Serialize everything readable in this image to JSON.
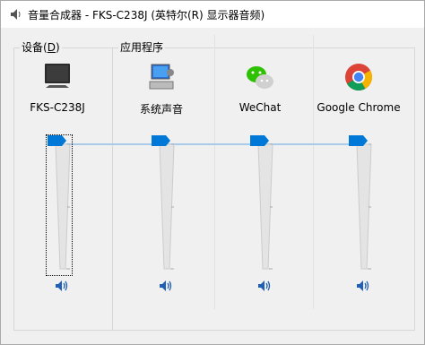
{
  "window": {
    "title": "音量合成器 - FKS-C238J (英特尔(R) 显示器音频)"
  },
  "device_group": {
    "title": "设备",
    "accesskey": "D",
    "device": {
      "name": "FKS-C238J",
      "icon": "monitor-icon",
      "volume_percent": 100,
      "muted": false
    }
  },
  "apps_group": {
    "title": "应用程序",
    "apps": [
      {
        "name": "系统声音",
        "icon": "system-sounds-icon",
        "volume_percent": 100,
        "muted": false
      },
      {
        "name": "WeChat",
        "icon": "wechat-icon",
        "volume_percent": 100,
        "muted": false
      },
      {
        "name": "Google Chrome",
        "icon": "chrome-icon",
        "volume_percent": 100,
        "muted": false
      }
    ]
  },
  "colors": {
    "accent": "#0078d7",
    "track": "#e4e4e4",
    "link_line": "#a9cbe9"
  }
}
